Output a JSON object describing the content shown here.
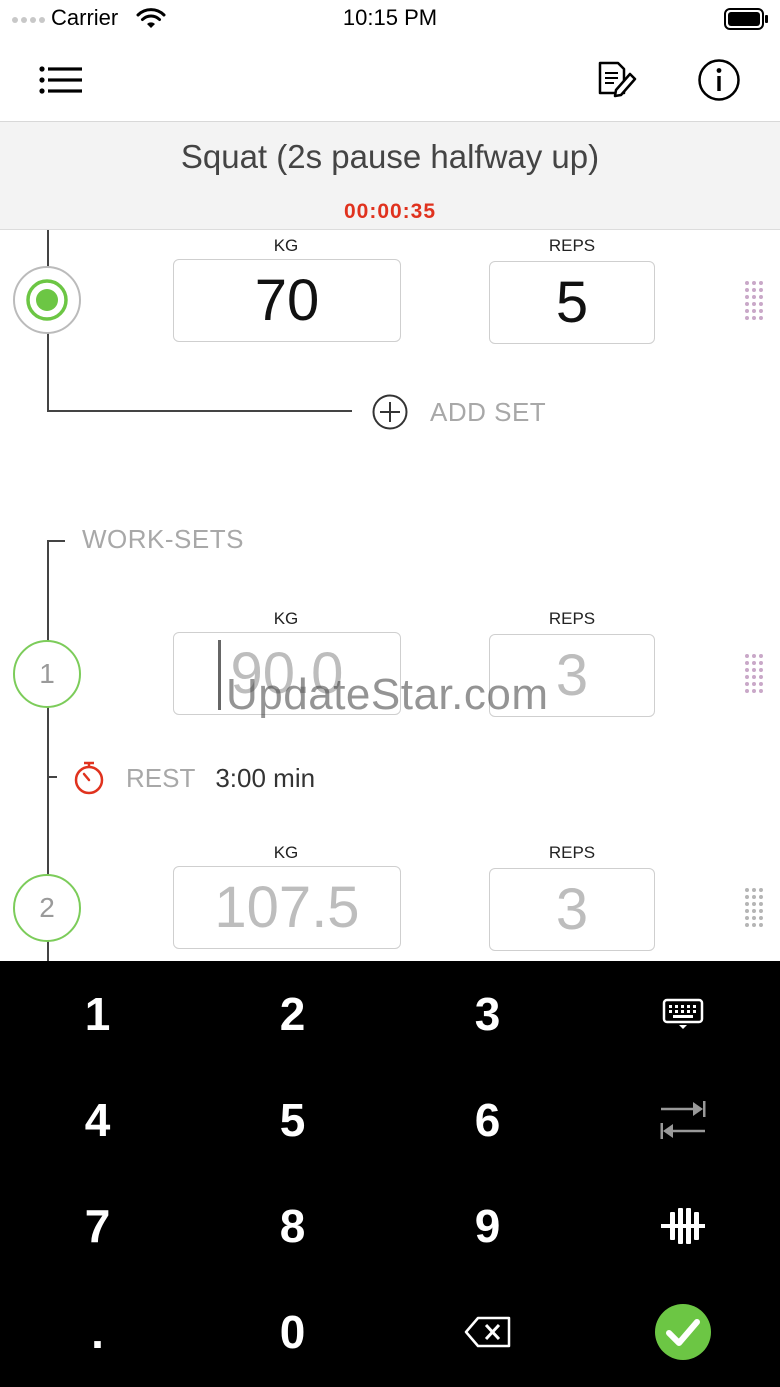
{
  "status_bar": {
    "carrier": "Carrier",
    "time": "10:15 PM"
  },
  "nav": {
    "menu_icon": "list-icon",
    "notes_icon": "edit-note-icon",
    "info_icon": "info-icon"
  },
  "exercise": {
    "title": "Squat (2s pause halfway up)",
    "timer": "00:00:35",
    "timer_color": "#e0321e"
  },
  "warmup_set": {
    "kg_label": "KG",
    "reps_label": "REPS",
    "kg": "70",
    "reps": "5"
  },
  "add_set": {
    "label": "ADD SET"
  },
  "work_sets": {
    "title": "WORK-SETS",
    "sets": [
      {
        "number": "1",
        "kg_label": "KG",
        "reps_label": "REPS",
        "kg": "90.0",
        "reps": "3"
      },
      {
        "number": "2",
        "kg_label": "KG",
        "reps_label": "REPS",
        "kg": "107.5",
        "reps": "3"
      }
    ],
    "rest": {
      "label": "REST",
      "value": "3:00 min"
    }
  },
  "watermark": "UpdateStar.com",
  "keypad": {
    "digits": [
      "1",
      "2",
      "3",
      "4",
      "5",
      "6",
      "7",
      "8",
      "9",
      ".",
      "0"
    ],
    "icons": [
      "keyboard-icon",
      "swap-icon",
      "plate-icon",
      "backspace-icon",
      "checkmark-icon"
    ]
  },
  "colors": {
    "accent_green": "#7ccc5a",
    "confirm_green": "#6cc644",
    "timer_red": "#e0321e"
  }
}
